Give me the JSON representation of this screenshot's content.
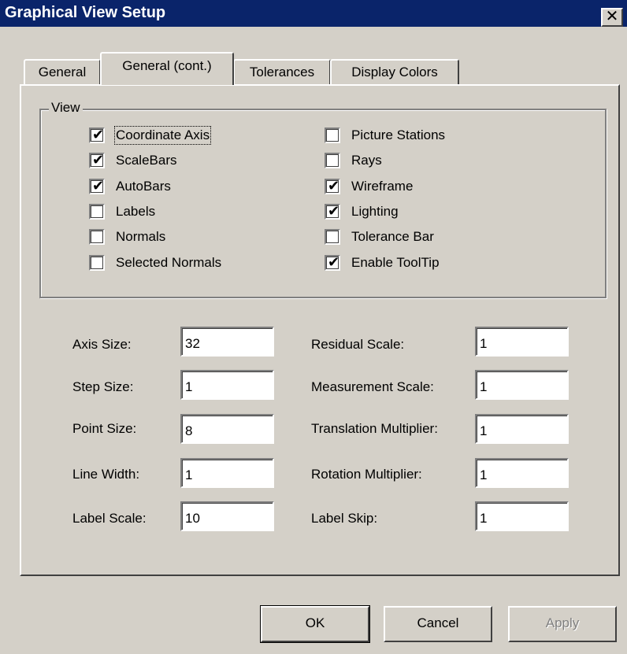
{
  "window": {
    "title": "Graphical View Setup",
    "close_glyph": "✕"
  },
  "tabs": [
    {
      "label": "General",
      "active": false
    },
    {
      "label": "General (cont.)",
      "active": true
    },
    {
      "label": "Tolerances",
      "active": false
    },
    {
      "label": "Display Colors",
      "active": false
    }
  ],
  "view_group": {
    "legend": "View",
    "left_column": [
      {
        "label": "Coordinate Axis",
        "checked": true
      },
      {
        "label": "ScaleBars",
        "checked": true
      },
      {
        "label": "AutoBars",
        "checked": true
      },
      {
        "label": "Labels",
        "checked": false
      },
      {
        "label": "Normals",
        "checked": false
      },
      {
        "label": "Selected Normals",
        "checked": false
      }
    ],
    "right_column": [
      {
        "label": "Picture Stations",
        "checked": false
      },
      {
        "label": "Rays",
        "checked": false
      },
      {
        "label": "Wireframe",
        "checked": true
      },
      {
        "label": "Lighting",
        "checked": true
      },
      {
        "label": "Tolerance Bar",
        "checked": false
      },
      {
        "label": "Enable ToolTip",
        "checked": true
      }
    ]
  },
  "fields": {
    "left": [
      {
        "label": "Axis Size:",
        "value": "32"
      },
      {
        "label": "Step Size:",
        "value": "1"
      },
      {
        "label": "Point Size:",
        "value": "8"
      },
      {
        "label": "Line Width:",
        "value": "1"
      },
      {
        "label": "Label Scale:",
        "value": "10"
      }
    ],
    "right": [
      {
        "label": "Residual Scale:",
        "value": "1"
      },
      {
        "label": "Measurement Scale:",
        "value": "1"
      },
      {
        "label": "Translation Multiplier:",
        "value": "1"
      },
      {
        "label": "Rotation Multiplier:",
        "value": "1"
      },
      {
        "label": "Label Skip:",
        "value": "1"
      }
    ]
  },
  "buttons": {
    "ok": "OK",
    "cancel": "Cancel",
    "apply": "Apply"
  },
  "colors": {
    "titlebar": "#0a246a",
    "face": "#d4d0c8"
  }
}
